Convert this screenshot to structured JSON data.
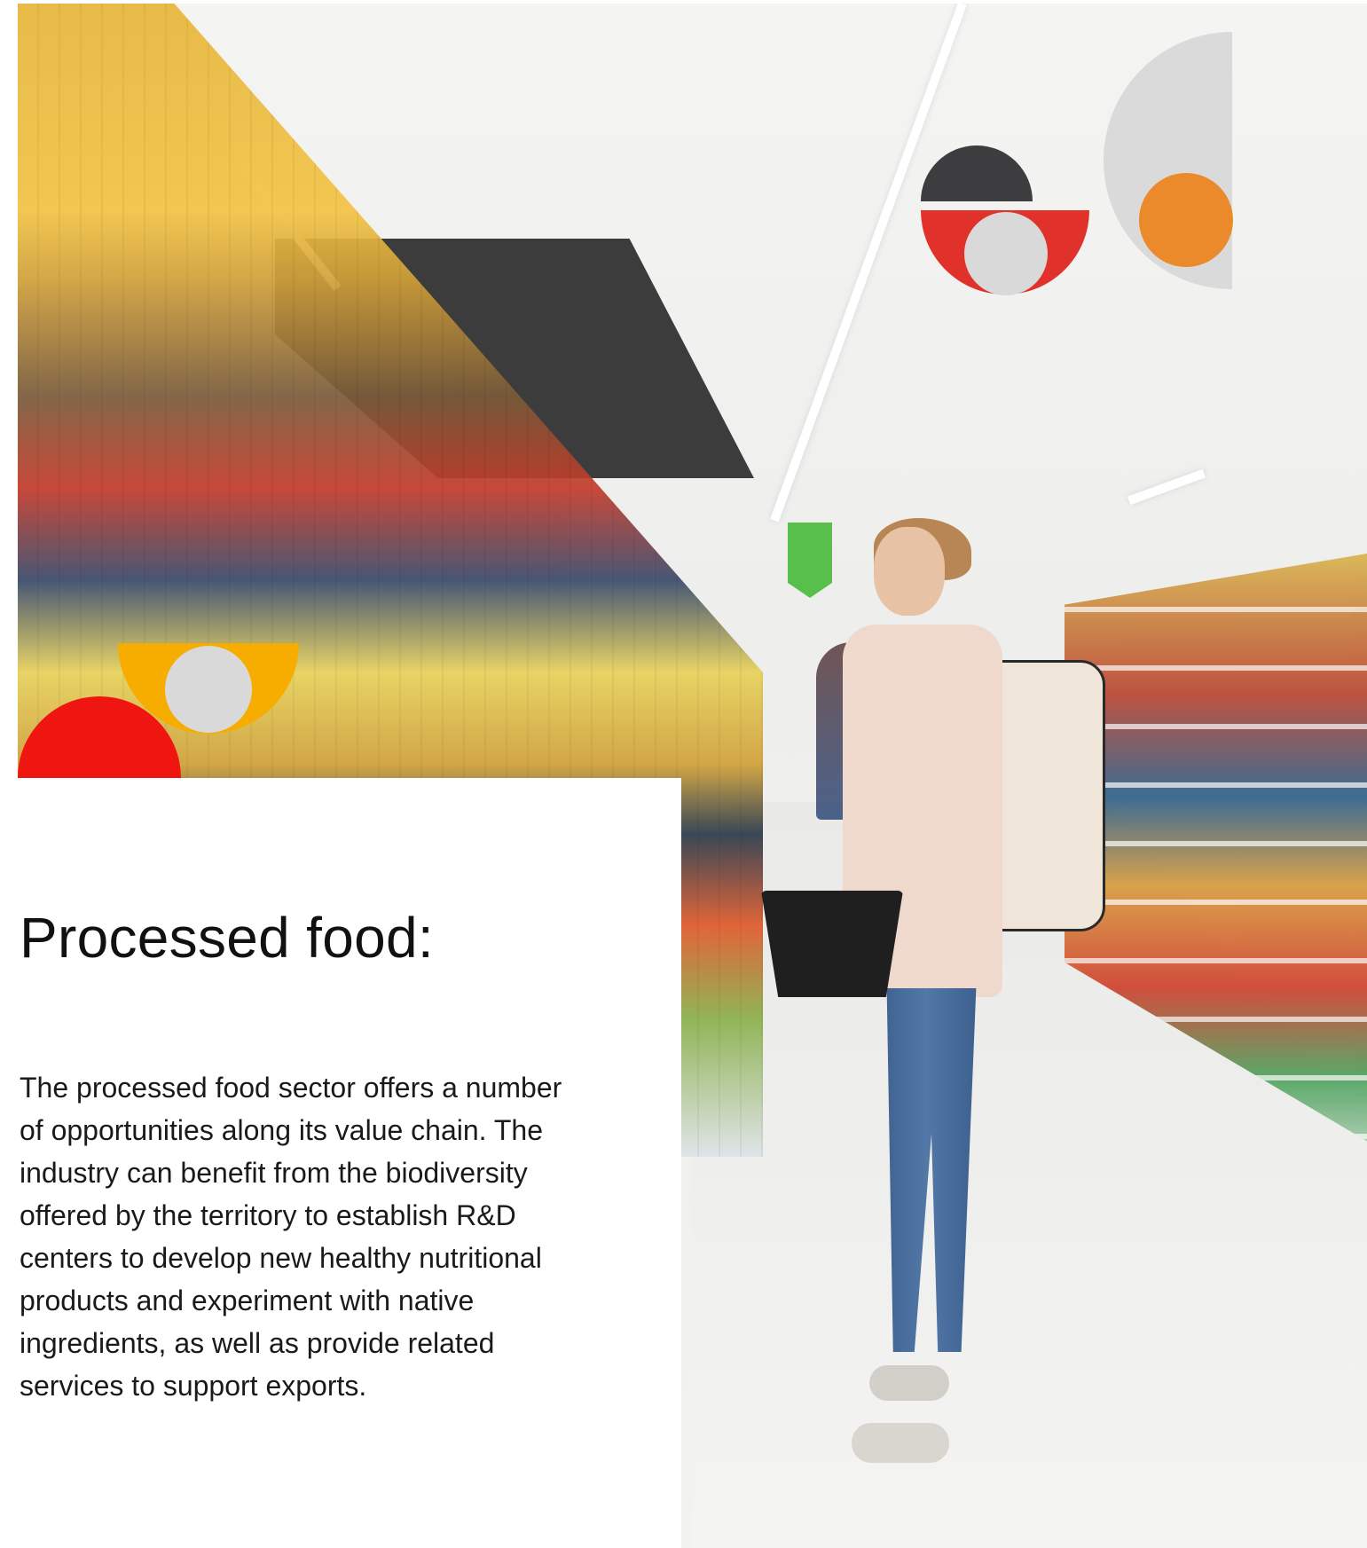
{
  "heading": "Processed food:",
  "body": "The processed food sector offers a number of opportunities along its value chain. The industry can benefit from the biodiversity offered by the territory to establish R&D centers to develop new healthy nutritional products and experiment with native ingredients, as well as provide related services to support exports.",
  "colors": {
    "red": "#ef1510",
    "yellow": "#f6ad00",
    "orange": "#ea8a2a",
    "grey": "#d9d9d9",
    "dark": "#3d3d3f"
  }
}
